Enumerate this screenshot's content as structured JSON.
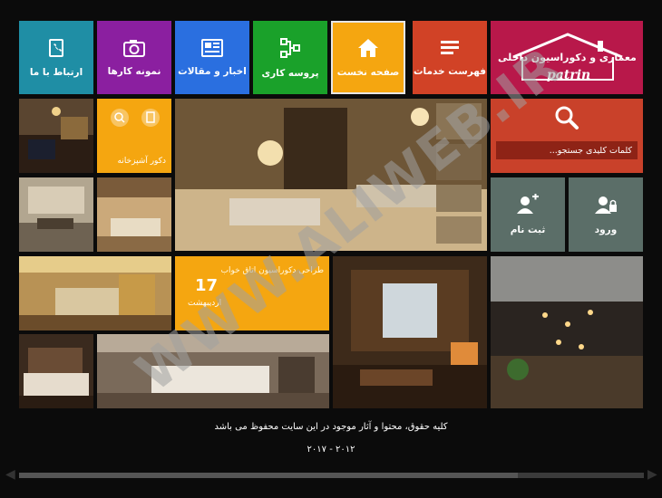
{
  "nav": {
    "contact": "ارتباط با ما",
    "portfolio": "نمونه کارها",
    "news": "اخبار و مقالات",
    "process": "پروسه کاری",
    "home": "صفحه نخست",
    "services": "فهرست خدمات"
  },
  "logo": {
    "line1": "معماری و دکوراسیون داخلی",
    "line2": "patrin"
  },
  "search": {
    "placeholder": "کلمات کلیدی جستجو..."
  },
  "account": {
    "register": "ثبت نام",
    "login": "ورود"
  },
  "kitchen_tile": {
    "label": "دکور آشپزخانه"
  },
  "date_tile": {
    "day": "17",
    "month": "اردیبهشت",
    "caption": "طراحی دکوراسیون اتاق خواب"
  },
  "footer": {
    "copyright": "کلیه حقوق، محتوا و آثار موجود در این سایت محفوظ می باشد",
    "years": "۲۰۱۲ - ۲۰۱۷"
  },
  "watermark": "WWW.ALIWEB.IR",
  "colors": {
    "contact": "#1f8ea5",
    "portfolio": "#8b1fa0",
    "news": "#2a6fe0",
    "process": "#1aa12a",
    "home": "#f5a610",
    "services": "#d14226",
    "logo": "#b8184a",
    "search": "#c9412a",
    "account": "#5b6e68",
    "accent_orange": "#f5a610"
  }
}
